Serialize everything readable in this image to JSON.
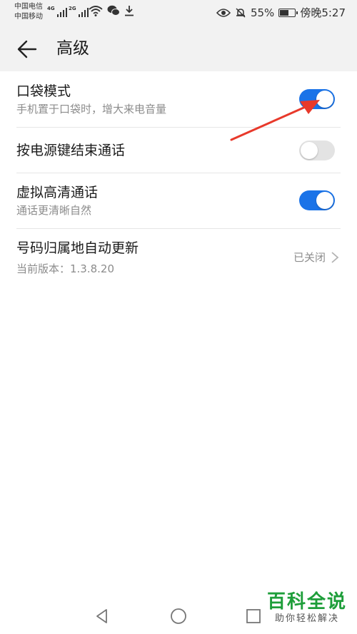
{
  "status_bar": {
    "carrier_1": "中国电信",
    "carrier_2": "中国移动",
    "sim1_tag": "4G",
    "sim2_tag": "2G",
    "icons_left": [
      "signal-icon",
      "signal-icon",
      "wifi-icon",
      "wechat-icon",
      "download-icon"
    ],
    "icons_right": [
      "eye-comfort-icon",
      "mute-icon",
      "battery-icon"
    ],
    "battery": "55%",
    "time": "傍晚5:27"
  },
  "header": {
    "back_icon": "arrow-left-icon",
    "title": "高级"
  },
  "settings": [
    {
      "title": "口袋模式",
      "subtitle": "手机置于口袋时，增大来电音量",
      "control": "toggle",
      "state": "on"
    },
    {
      "title": "按电源键结束通话",
      "control": "toggle",
      "state": "off"
    },
    {
      "title": "虚拟高清通话",
      "subtitle": "通话更清晰自然",
      "control": "toggle",
      "state": "on"
    },
    {
      "title": "号码归属地自动更新",
      "subtitle": "当前版本：1.3.8.20",
      "control": "link",
      "value": "已关闭"
    }
  ],
  "annotation": {
    "type": "red-arrow",
    "points_to": "口袋模式 toggle"
  },
  "nav_bar": {
    "icons": [
      "back-triangle-icon",
      "home-circle-icon",
      "recents-square-icon"
    ]
  },
  "watermark": {
    "title": "百科全说",
    "subtitle": "助你轻松解决"
  },
  "colors": {
    "accent": "#1a73e8",
    "annotation": "#e8392b",
    "watermark": "#1e9e3a"
  }
}
